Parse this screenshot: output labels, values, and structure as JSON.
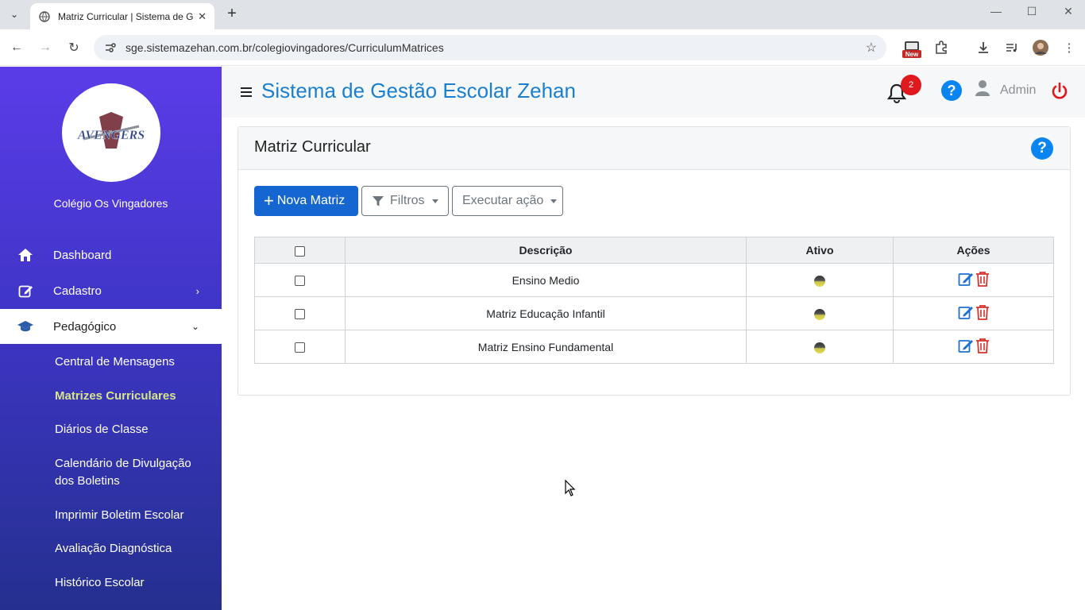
{
  "browser": {
    "tab_title": "Matriz Curricular | Sistema de G",
    "url": "sge.sistemazehan.com.br/colegiovingadores/CurriculumMatrices",
    "new_badge": "New"
  },
  "sidebar": {
    "school_name": "Colégio Os Vingadores",
    "logo_text": "AVENGERS",
    "items": [
      {
        "label": "Dashboard",
        "icon": "home-icon"
      },
      {
        "label": "Cadastro",
        "icon": "edit-icon"
      },
      {
        "label": "Pedagógico",
        "icon": "graduation-cap-icon"
      }
    ],
    "subitems": [
      "Central de Mensagens",
      "Matrizes Curriculares",
      "Diários de Classe",
      "Calendário de Divulgação dos Boletins",
      "Imprimir Boletim Escolar",
      "Avaliação Diagnóstica",
      "Histórico Escolar"
    ]
  },
  "header": {
    "title": "Sistema de Gestão Escolar Zehan",
    "notifications": "2",
    "user": "Admin"
  },
  "card": {
    "title": "Matriz Curricular",
    "buttons": {
      "new": "Nova Matriz",
      "filter": "Filtros",
      "action": "Executar ação"
    },
    "table": {
      "headers": [
        "Descrição",
        "Ativo",
        "Ações"
      ],
      "rows": [
        {
          "descricao": "Ensino Medio"
        },
        {
          "descricao": "Matriz Educação Infantil"
        },
        {
          "descricao": "Matriz Ensino Fundamental"
        }
      ]
    }
  },
  "colors": {
    "accent": "#1a7fcf",
    "primary_button": "#1666d1",
    "sidebar_top": "#5b3ce8",
    "sidebar_bottom": "#24308f",
    "current_subitem": "#d7e58a",
    "danger": "#d9322b"
  }
}
